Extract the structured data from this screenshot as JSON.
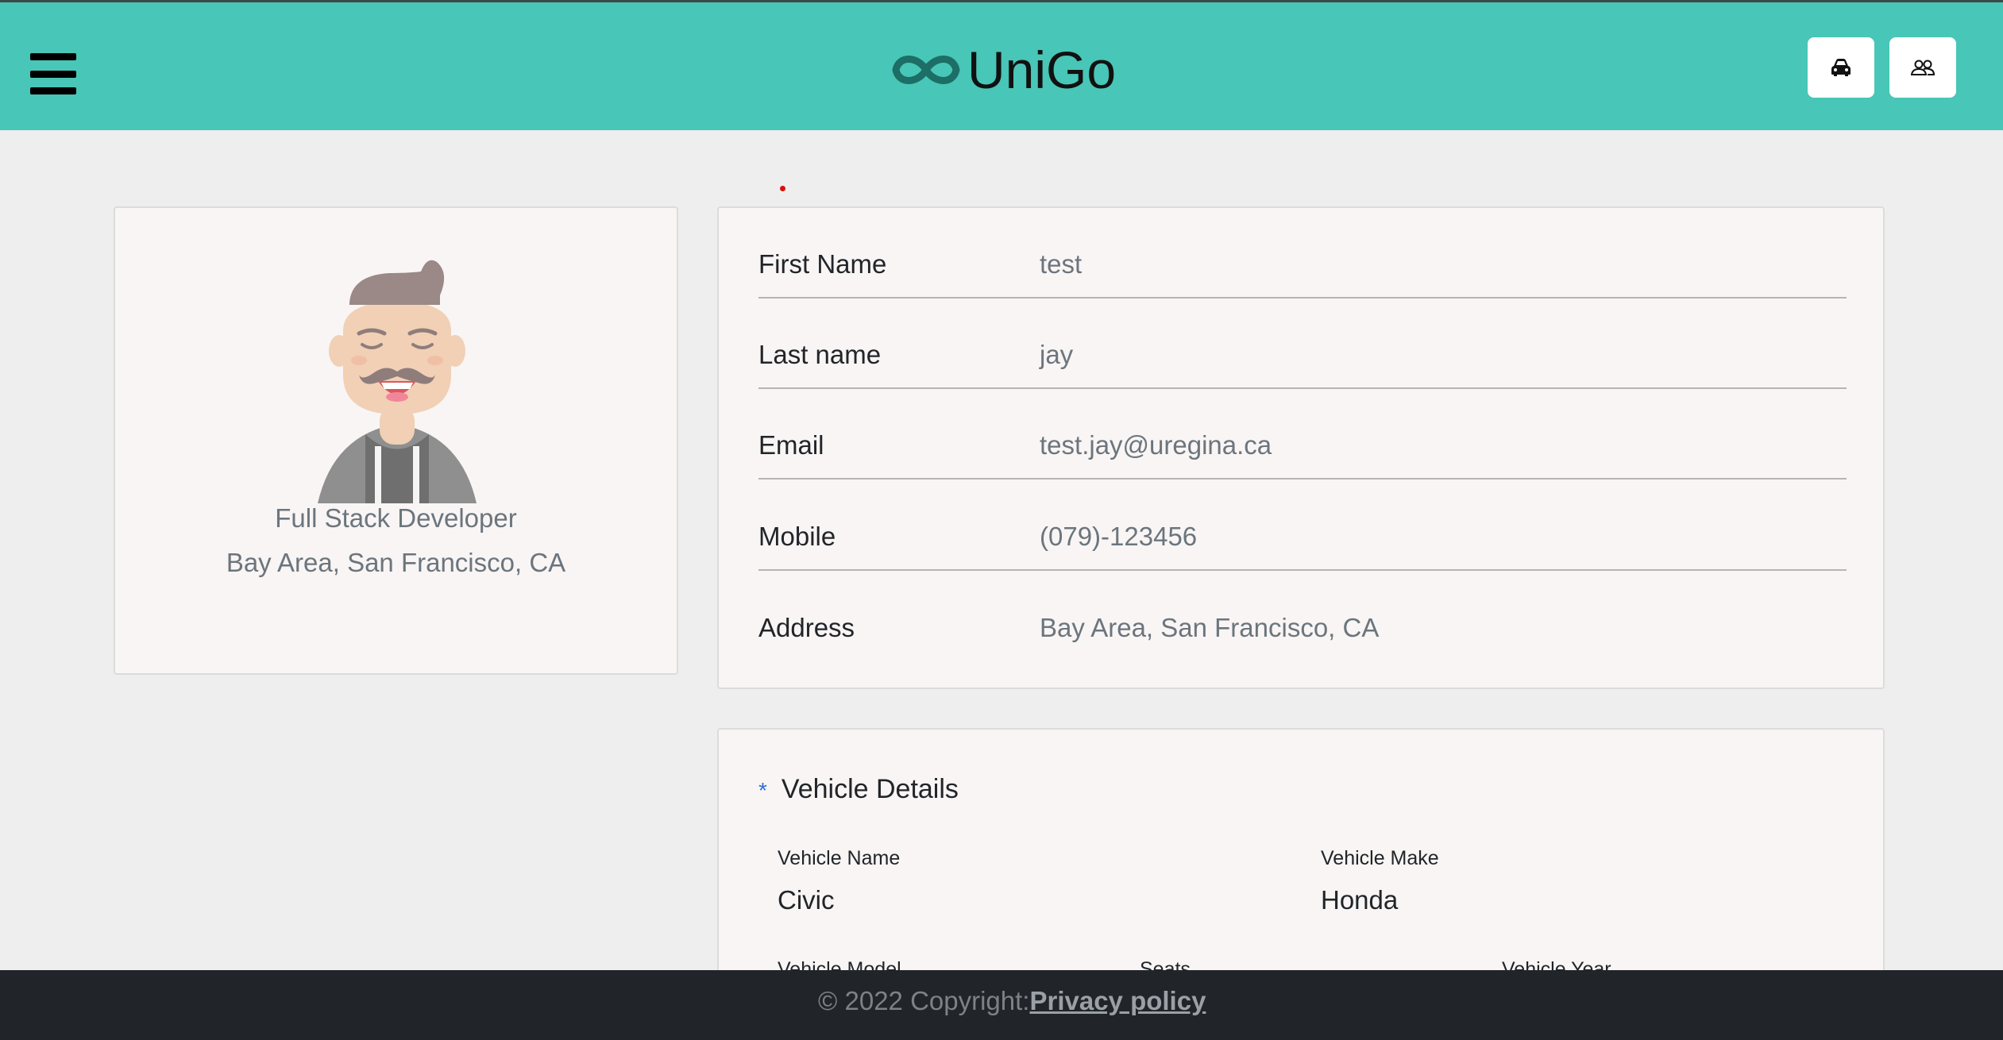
{
  "navbar": {
    "brand": "UniGo",
    "menu_icon": "hamburger-menu-icon",
    "car_icon": "car-icon",
    "people_icon": "people-icon",
    "accent": "#48c6b7"
  },
  "profile": {
    "role": "Full Stack Developer",
    "location": "Bay Area, San Francisco, CA"
  },
  "info": {
    "rows": [
      {
        "label": "First Name",
        "value": "test"
      },
      {
        "label": "Last name",
        "value": "jay"
      },
      {
        "label": "Email",
        "value": "test.jay@uregina.ca"
      },
      {
        "label": "Mobile",
        "value": "(079)-123456"
      },
      {
        "label": "Address",
        "value": "Bay Area, San Francisco, CA"
      }
    ]
  },
  "vehicle": {
    "asterisk": "*",
    "title": "Vehicle Details",
    "name_label": "Vehicle Name",
    "name_value": "Civic",
    "make_label": "Vehicle Make",
    "make_value": "Honda",
    "model_label": "Vehicle Model",
    "seats_label": "Seats",
    "year_label": "Vehicle Year"
  },
  "footer": {
    "copyright": "© 2022 Copyright:",
    "link": "Privacy policy"
  }
}
